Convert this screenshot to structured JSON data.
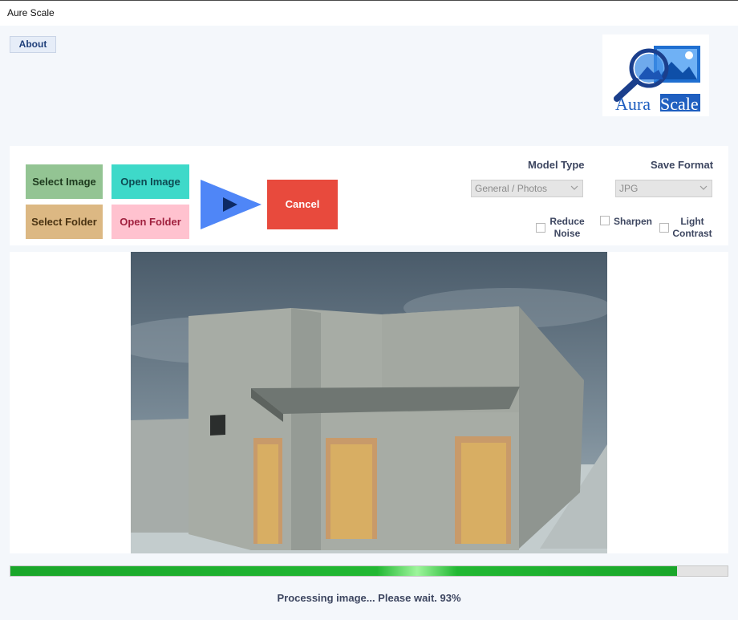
{
  "window": {
    "title": "Aure Scale"
  },
  "header": {
    "about_label": "About",
    "logo_text_left": "Aura",
    "logo_text_right": "Scale"
  },
  "actions": {
    "select_image": "Select Image",
    "open_image": "Open Image",
    "select_folder": "Select Folder",
    "open_folder": "Open Folder",
    "cancel": "Cancel"
  },
  "settings": {
    "model_type_label": "Model Type",
    "model_type_value": "General / Photos",
    "save_format_label": "Save Format",
    "save_format_value": "JPG",
    "reduce_noise_line1": "Reduce",
    "reduce_noise_line2": "Noise",
    "sharpen_label": "Sharpen",
    "light_contrast_line1": "Light",
    "light_contrast_line2": "Contrast"
  },
  "progress": {
    "value_percent": 93,
    "status_text": "Processing image... Please wait. 93%"
  },
  "colors": {
    "accent_green": "#1aa62a",
    "cancel_red": "#e84a3d",
    "play_blue": "#4f86f7"
  }
}
